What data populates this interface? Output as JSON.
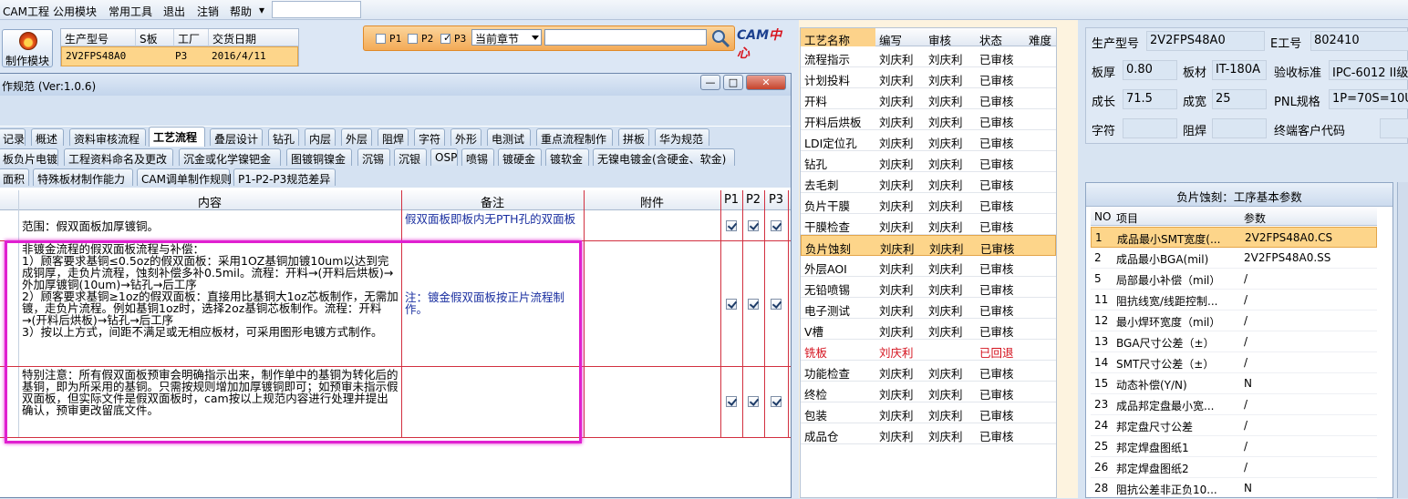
{
  "menu": {
    "items": [
      "CAM工程",
      "公用模块",
      "常用工具",
      "退出",
      "注销",
      "帮助"
    ],
    "help_arrow": "▾"
  },
  "make_module_button": "制作模块",
  "order_info": {
    "headers": [
      "生产型号",
      "S板",
      "工厂",
      "交货日期"
    ],
    "row": [
      "2V2FPS48A0",
      "",
      "P3",
      "2016/4/11"
    ]
  },
  "dialog": {
    "title": "作规范 (Ver:1.0.6)",
    "win_buttons": [
      "—",
      "□",
      "✕"
    ],
    "filters": [
      {
        "label": "P1",
        "checked": false
      },
      {
        "label": "P2",
        "checked": false
      },
      {
        "label": "P3",
        "checked": true
      }
    ],
    "chapter_select": "当前章节",
    "search_value": "",
    "logo_cam": "CAM",
    "logo_center": "中心",
    "tabs_row1": [
      "记录",
      "概述",
      "资料审核流程",
      "工艺流程",
      "叠层设计",
      "钻孔",
      "内层",
      "外层",
      "阻焊",
      "字符",
      "外形",
      "电测试",
      "重点流程制作",
      "拼板",
      "华为规范"
    ],
    "tabs_row2": [
      "板负片电镀",
      "工程资料命名及更改",
      "沉金或化学镍钯金",
      "图镀铜镍金",
      "沉锡",
      "沉银",
      "OSP",
      "喷锡",
      "镀硬金",
      "镀软金",
      "无镍电镀金(含硬金、软金)"
    ],
    "tabs_row3": [
      "面积",
      "特殊板材制作能力",
      "CAM调单制作规则",
      "P1-P2-P3规范差异"
    ],
    "active_tab": "工艺流程",
    "grid_headers": [
      "内容",
      "备注",
      "附件",
      "P1",
      "P2",
      "P3"
    ],
    "rows": [
      {
        "content": "范围：假双面板加厚镀铜。",
        "note": "假双面板即板内无PTH孔的双面板",
        "attach": "",
        "p1": true,
        "p2": true,
        "p3": true
      },
      {
        "content": "非镀金流程的假双面板流程与补偿：\n1）顾客要求基铜≤0.5oz的假双面板：采用1OZ基铜加镀10um以达到完成铜厚，走负片流程，蚀刻补偿多补0.5mil。流程：开料→(开料后烘板)→外加厚镀铜(10um)→钻孔→后工序\n2）顾客要求基铜≥1oz的假双面板：直接用比基铜大1oz芯板制作，无需加镀，走负片流程。例如基铜1oz时，选择2oz基铜芯板制作。流程：开料→(开料后烘板)→钻孔→后工序\n3）按以上方式，间距不满足或无相应板材，可采用图形电镀方式制作。",
        "note": "注：镀金假双面板按正片流程制作。",
        "attach": "",
        "p1": true,
        "p2": true,
        "p3": true
      },
      {
        "content": "特别注意：所有假双面板预审会明确指示出来，制作单中的基铜为转化后的基铜，即为所采用的基铜。只需按规则增加加厚镀铜即可；如预审未指示假双面板，但实际文件是假双面板时，cam按以上规范内容进行处理并提出确认，预审更改留底文件。",
        "note": "",
        "attach": "",
        "p1": true,
        "p2": true,
        "p3": true
      }
    ]
  },
  "process_table": {
    "headers": [
      "工艺名称",
      "编写",
      "审核",
      "状态",
      "难度"
    ],
    "rows": [
      {
        "name": "流程指示",
        "writer": "刘庆利",
        "reviewer": "刘庆利",
        "status": "已审核",
        "level": ""
      },
      {
        "name": "计划投料",
        "writer": "刘庆利",
        "reviewer": "刘庆利",
        "status": "已审核",
        "level": ""
      },
      {
        "name": "开料",
        "writer": "刘庆利",
        "reviewer": "刘庆利",
        "status": "已审核",
        "level": ""
      },
      {
        "name": "开料后烘板",
        "writer": "刘庆利",
        "reviewer": "刘庆利",
        "status": "已审核",
        "level": ""
      },
      {
        "name": "LDI定位孔",
        "writer": "刘庆利",
        "reviewer": "刘庆利",
        "status": "已审核",
        "level": ""
      },
      {
        "name": "钻孔",
        "writer": "刘庆利",
        "reviewer": "刘庆利",
        "status": "已审核",
        "level": ""
      },
      {
        "name": "去毛刺",
        "writer": "刘庆利",
        "reviewer": "刘庆利",
        "status": "已审核",
        "level": ""
      },
      {
        "name": "负片干膜",
        "writer": "刘庆利",
        "reviewer": "刘庆利",
        "status": "已审核",
        "level": ""
      },
      {
        "name": "干膜检查",
        "writer": "刘庆利",
        "reviewer": "刘庆利",
        "status": "已审核",
        "level": ""
      },
      {
        "name": "负片蚀刻",
        "writer": "刘庆利",
        "reviewer": "刘庆利",
        "status": "已审核",
        "level": "",
        "selected": true
      },
      {
        "name": "外层AOI",
        "writer": "刘庆利",
        "reviewer": "刘庆利",
        "status": "已审核",
        "level": ""
      },
      {
        "name": "无铅喷锡",
        "writer": "刘庆利",
        "reviewer": "刘庆利",
        "status": "已审核",
        "level": ""
      },
      {
        "name": "电子测试",
        "writer": "刘庆利",
        "reviewer": "刘庆利",
        "status": "已审核",
        "level": ""
      },
      {
        "name": "V槽",
        "writer": "刘庆利",
        "reviewer": "刘庆利",
        "status": "已审核",
        "level": ""
      },
      {
        "name": "铣板",
        "writer": "刘庆利",
        "reviewer": "",
        "status": "已回退",
        "level": "",
        "returned": true
      },
      {
        "name": "功能检查",
        "writer": "刘庆利",
        "reviewer": "刘庆利",
        "status": "已审核",
        "level": ""
      },
      {
        "name": "终检",
        "writer": "刘庆利",
        "reviewer": "刘庆利",
        "status": "已审核",
        "level": ""
      },
      {
        "name": "包装",
        "writer": "刘庆利",
        "reviewer": "刘庆利",
        "status": "已审核",
        "level": ""
      },
      {
        "name": "成品仓",
        "writer": "刘庆利",
        "reviewer": "刘庆利",
        "status": "已审核",
        "level": ""
      }
    ]
  },
  "form": {
    "model_label": "生产型号",
    "model_value": "2V2FPS48A0",
    "eno_label": "E工号",
    "eno_value": "802410",
    "thick_label": "板厚",
    "thick_value": "0.80",
    "material_label": "板材",
    "material_value": "IT-180A",
    "std_label": "验收标准",
    "std_value": "IPC-6012 II级",
    "len_label": "成长",
    "len_value": "71.5",
    "width_label": "成宽",
    "width_value": "25",
    "pnl_label": "PNL规格",
    "pnl_value": "1P=70S=10U",
    "char_label": "字符",
    "char_value": "",
    "mask_label": "阻焊",
    "mask_value": "",
    "cust_label": "终端客户代码",
    "cust_value": ""
  },
  "params": {
    "title": "负片蚀刻：工序基本参数",
    "headers": [
      "NO",
      "项目",
      "参数"
    ],
    "rows": [
      {
        "no": "1",
        "item": "成品最小SMT宽度(...",
        "value": "2V2FPS48A0.CS",
        "selected": true
      },
      {
        "no": "2",
        "item": "成品最小BGA(mil)",
        "value": "2V2FPS48A0.SS"
      },
      {
        "no": "5",
        "item": "局部最小补偿（mil）",
        "value": "/"
      },
      {
        "no": "11",
        "item": "阻抗线宽/线距控制...",
        "value": "/"
      },
      {
        "no": "12",
        "item": "最小焊环宽度（mil）",
        "value": "/"
      },
      {
        "no": "13",
        "item": "BGA尺寸公差（±）",
        "value": "/"
      },
      {
        "no": "14",
        "item": "SMT尺寸公差（±）",
        "value": "/"
      },
      {
        "no": "15",
        "item": "动态补偿(Y/N)",
        "value": "N"
      },
      {
        "no": "23",
        "item": "成品邦定盘最小宽...",
        "value": "/"
      },
      {
        "no": "24",
        "item": "邦定盘尺寸公差",
        "value": "/"
      },
      {
        "no": "25",
        "item": "邦定焊盘图纸1",
        "value": "/"
      },
      {
        "no": "26",
        "item": "邦定焊盘图纸2",
        "value": "/"
      },
      {
        "no": "28",
        "item": "阻抗公差非正负10...",
        "value": "N"
      }
    ]
  },
  "colors": {
    "highlight": "#e020d0",
    "selected_row": "#fdd58a",
    "returned": "#d4101c"
  }
}
